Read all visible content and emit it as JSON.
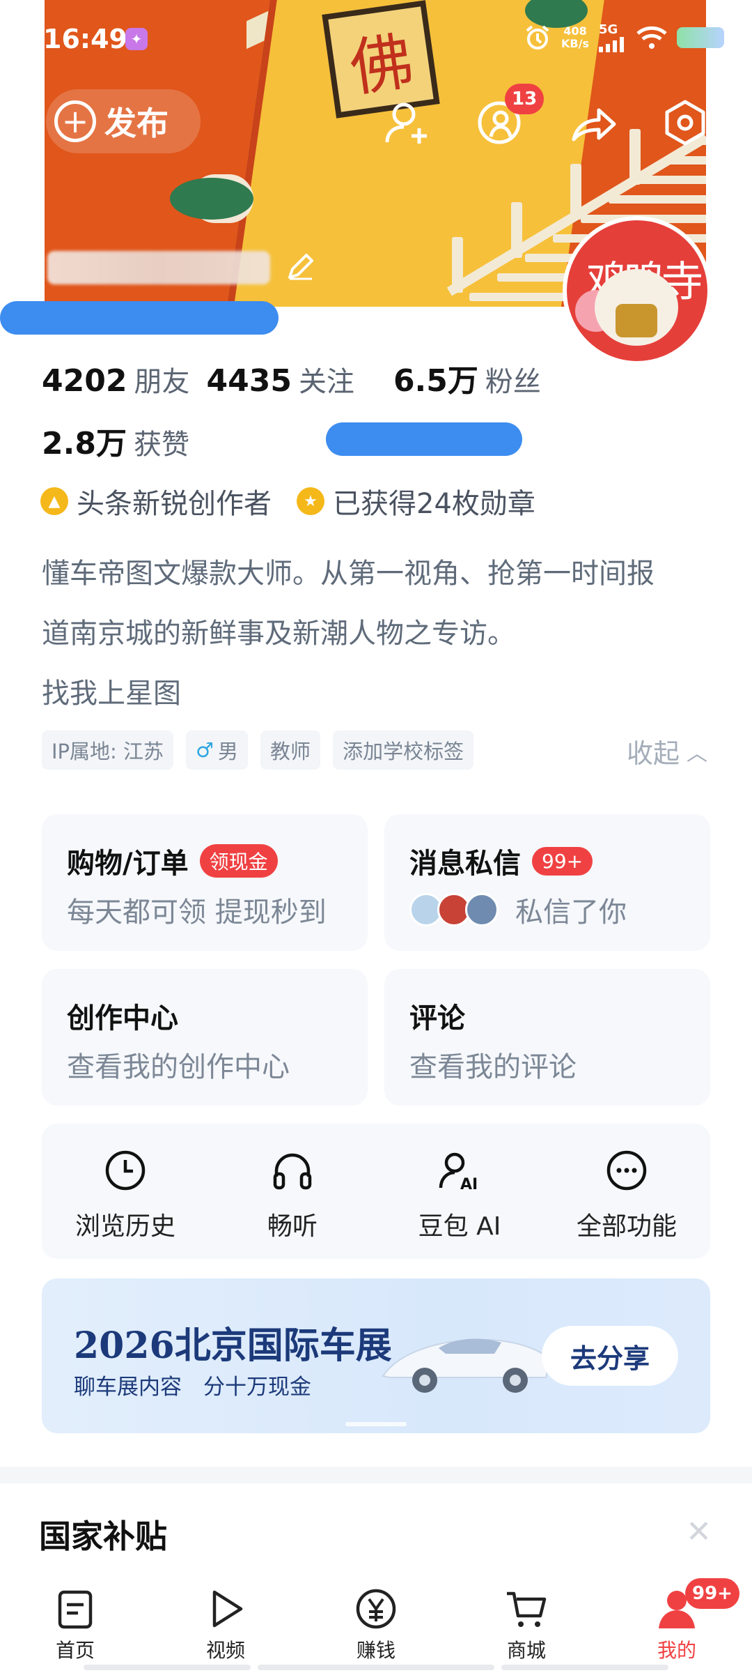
{
  "status_bar": {
    "time": "16:49",
    "speed_value": "408",
    "speed_unit": "KB/s",
    "network": "5G"
  },
  "header": {
    "publish_label": "发布",
    "notification_count": "13",
    "banner_plaque_char": "佛"
  },
  "stats": [
    {
      "value": "4202",
      "label": "朋友"
    },
    {
      "value": "4435",
      "label": "关注"
    },
    {
      "value": "6.5万",
      "label": "粉丝"
    },
    {
      "value": "2.8万",
      "label": "获赞"
    }
  ],
  "badges": {
    "creator": "头条新锐创作者",
    "medals": "已获得24枚勋章"
  },
  "bio": {
    "line1": "懂车帝图文爆款大师。从第一视角、抢第一时间报",
    "line2": "道南京城的新鲜事及新潮人物之专访。",
    "line3": "找我上星图"
  },
  "tags": [
    "IP属地: 江苏",
    "男",
    "教师",
    "添加学校标签"
  ],
  "collapse_label": "收起",
  "cards": {
    "shopping": {
      "title": "购物/订单",
      "pill": "领现金",
      "sub": "每天都可领 提现秒到"
    },
    "messages": {
      "title": "消息私信",
      "pill": "99+",
      "sub": "私信了你"
    },
    "creation": {
      "title": "创作中心",
      "sub": "查看我的创作中心"
    },
    "comments": {
      "title": "评论",
      "sub": "查看我的评论"
    }
  },
  "functions": [
    {
      "label": "浏览历史",
      "icon": "clock-icon"
    },
    {
      "label": "畅听",
      "icon": "headphones-icon"
    },
    {
      "label": "豆包 AI",
      "icon": "ai-person-icon"
    },
    {
      "label": "全部功能",
      "icon": "more-icon"
    }
  ],
  "promo": {
    "title": "2026北京国际车展",
    "subtitle": "聊车展内容　分十万现金",
    "button": "去分享"
  },
  "section": {
    "title": "国家补贴"
  },
  "nav": {
    "items": [
      {
        "label": "首页",
        "icon": "home-doc-icon"
      },
      {
        "label": "视频",
        "icon": "play-icon"
      },
      {
        "label": "赚钱",
        "icon": "yuan-icon"
      },
      {
        "label": "商城",
        "icon": "cart-icon"
      },
      {
        "label": "我的",
        "icon": "user-icon"
      }
    ],
    "mine_badge": "99+"
  },
  "colors": {
    "accent_red": "#f04142",
    "text_gray": "#5b6472",
    "promo_blue": "#1c3a7a"
  }
}
